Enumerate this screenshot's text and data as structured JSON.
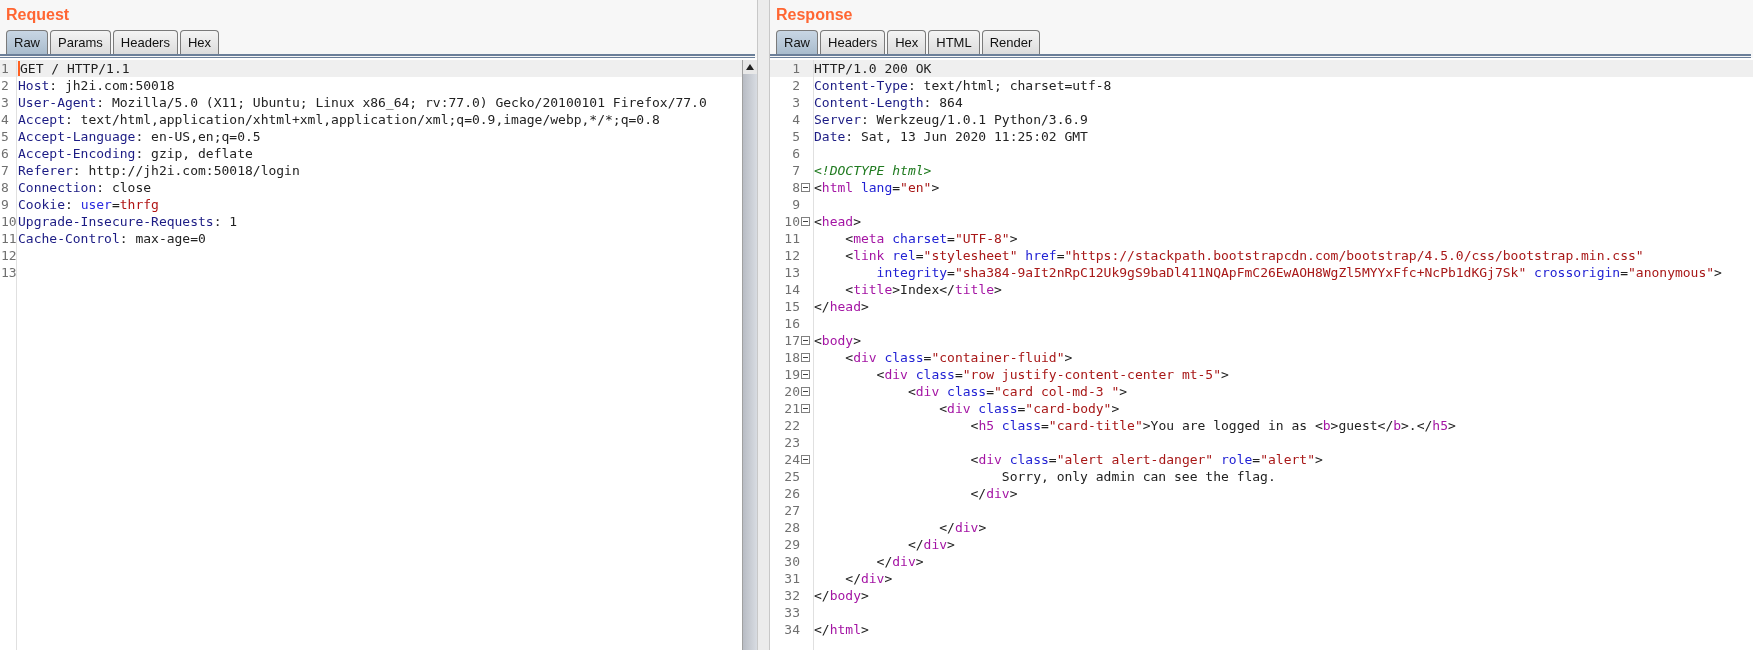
{
  "panes": [
    {
      "title": "Request",
      "caret": true,
      "scrollbar": true,
      "tabs": [
        {
          "label": "Raw",
          "selected": true
        },
        {
          "label": "Params",
          "selected": false
        },
        {
          "label": "Headers",
          "selected": false
        },
        {
          "label": "Hex",
          "selected": false
        }
      ],
      "lines": [
        {
          "number": "1",
          "current": true,
          "fold": false,
          "tokens": [
            {
              "kind": "text",
              "text": "GET / HTTP/1.1"
            }
          ]
        },
        {
          "number": "2",
          "current": false,
          "fold": false,
          "tokens": [
            {
              "kind": "header_name",
              "text": "Host"
            },
            {
              "kind": "text",
              "text": ": jh2i.com:50018"
            }
          ]
        },
        {
          "number": "3",
          "current": false,
          "fold": false,
          "tokens": [
            {
              "kind": "header_name",
              "text": "User-Agent"
            },
            {
              "kind": "text",
              "text": ": Mozilla/5.0 (X11; Ubuntu; Linux x86_64; rv:77.0) Gecko/20100101 Firefox/77.0"
            }
          ]
        },
        {
          "number": "4",
          "current": false,
          "fold": false,
          "tokens": [
            {
              "kind": "header_name",
              "text": "Accept"
            },
            {
              "kind": "text",
              "text": ": text/html,application/xhtml+xml,application/xml;q=0.9,image/webp,*/*;q=0.8"
            }
          ]
        },
        {
          "number": "5",
          "current": false,
          "fold": false,
          "tokens": [
            {
              "kind": "header_name",
              "text": "Accept-Language"
            },
            {
              "kind": "text",
              "text": ": en-US,en;q=0.5"
            }
          ]
        },
        {
          "number": "6",
          "current": false,
          "fold": false,
          "tokens": [
            {
              "kind": "header_name",
              "text": "Accept-Encoding"
            },
            {
              "kind": "text",
              "text": ": gzip, deflate"
            }
          ]
        },
        {
          "number": "7",
          "current": false,
          "fold": false,
          "tokens": [
            {
              "kind": "header_name",
              "text": "Referer"
            },
            {
              "kind": "text",
              "text": ": http://jh2i.com:50018/login"
            }
          ]
        },
        {
          "number": "8",
          "current": false,
          "fold": false,
          "tokens": [
            {
              "kind": "header_name",
              "text": "Connection"
            },
            {
              "kind": "text",
              "text": ": close"
            }
          ]
        },
        {
          "number": "9",
          "current": false,
          "fold": false,
          "tokens": [
            {
              "kind": "header_name",
              "text": "Cookie"
            },
            {
              "kind": "text",
              "text": ": "
            },
            {
              "kind": "param_name",
              "text": "user"
            },
            {
              "kind": "text",
              "text": "="
            },
            {
              "kind": "param_value",
              "text": "thrfg"
            }
          ]
        },
        {
          "number": "10",
          "current": false,
          "fold": false,
          "tokens": [
            {
              "kind": "header_name",
              "text": "Upgrade-Insecure-Requests"
            },
            {
              "kind": "text",
              "text": ": 1"
            }
          ]
        },
        {
          "number": "11",
          "current": false,
          "fold": false,
          "tokens": [
            {
              "kind": "header_name",
              "text": "Cache-Control"
            },
            {
              "kind": "text",
              "text": ": max-age=0"
            }
          ]
        },
        {
          "number": "12",
          "current": false,
          "fold": false
        },
        {
          "number": "13",
          "current": false,
          "fold": false
        }
      ]
    },
    {
      "title": "Response",
      "caret": false,
      "scrollbar": false,
      "tabs": [
        {
          "label": "Raw",
          "selected": true
        },
        {
          "label": "Headers",
          "selected": false
        },
        {
          "label": "Hex",
          "selected": false
        },
        {
          "label": "HTML",
          "selected": false
        },
        {
          "label": "Render",
          "selected": false
        }
      ],
      "lines": [
        {
          "number": "1",
          "current": true,
          "fold": false,
          "tokens": [
            {
              "kind": "text",
              "text": "HTTP/1.0 200 OK"
            }
          ]
        },
        {
          "number": "2",
          "current": false,
          "fold": false,
          "tokens": [
            {
              "kind": "header_name",
              "text": "Content-Type"
            },
            {
              "kind": "text",
              "text": ": text/html; charset=utf-8"
            }
          ]
        },
        {
          "number": "3",
          "current": false,
          "fold": false,
          "tokens": [
            {
              "kind": "header_name",
              "text": "Content-Length"
            },
            {
              "kind": "text",
              "text": ": 864"
            }
          ]
        },
        {
          "number": "4",
          "current": false,
          "fold": false,
          "tokens": [
            {
              "kind": "header_name",
              "text": "Server"
            },
            {
              "kind": "text",
              "text": ": Werkzeug/1.0.1 Python/3.6.9"
            }
          ]
        },
        {
          "number": "5",
          "current": false,
          "fold": false,
          "tokens": [
            {
              "kind": "header_name",
              "text": "Date"
            },
            {
              "kind": "text",
              "text": ": Sat, 13 Jun 2020 11:25:02 GMT"
            }
          ]
        },
        {
          "number": "6",
          "current": false,
          "fold": false
        },
        {
          "number": "7",
          "current": false,
          "fold": false,
          "tokens": [
            {
              "kind": "comment",
              "text": "<!DOCTYPE html>"
            }
          ]
        },
        {
          "number": "8",
          "current": false,
          "fold": true,
          "tokens": [
            {
              "kind": "text",
              "text": "<"
            },
            {
              "kind": "tag",
              "text": "html"
            },
            {
              "kind": "attr",
              "text": " lang"
            },
            {
              "kind": "text",
              "text": "="
            },
            {
              "kind": "string",
              "text": "\"en\""
            },
            {
              "kind": "text",
              "text": ">"
            }
          ]
        },
        {
          "number": "9",
          "current": false,
          "fold": false
        },
        {
          "number": "10",
          "current": false,
          "fold": true,
          "tokens": [
            {
              "kind": "text",
              "text": "<"
            },
            {
              "kind": "tag",
              "text": "head"
            },
            {
              "kind": "text",
              "text": ">"
            }
          ]
        },
        {
          "number": "11",
          "current": false,
          "fold": false,
          "tokens": [
            {
              "kind": "text",
              "text": "    <"
            },
            {
              "kind": "tag",
              "text": "meta"
            },
            {
              "kind": "attr",
              "text": " charset"
            },
            {
              "kind": "text",
              "text": "="
            },
            {
              "kind": "string",
              "text": "\"UTF-8\""
            },
            {
              "kind": "text",
              "text": ">"
            }
          ]
        },
        {
          "number": "12",
          "current": false,
          "fold": false,
          "tokens": [
            {
              "kind": "text",
              "text": "    <"
            },
            {
              "kind": "tag",
              "text": "link"
            },
            {
              "kind": "attr",
              "text": " rel"
            },
            {
              "kind": "text",
              "text": "="
            },
            {
              "kind": "string",
              "text": "\"stylesheet\""
            },
            {
              "kind": "attr",
              "text": " href"
            },
            {
              "kind": "text",
              "text": "="
            },
            {
              "kind": "string",
              "text": "\"https://stackpath.bootstrapcdn.com/bootstrap/4.5.0/css/bootstrap.min.css\""
            }
          ]
        },
        {
          "number": "13",
          "current": false,
          "fold": false,
          "tokens": [
            {
              "kind": "attr",
              "text": "        integrity"
            },
            {
              "kind": "text",
              "text": "="
            },
            {
              "kind": "string",
              "text": "\"sha384-9aIt2nRpC12Uk9gS9baDl411NQApFmC26EwAOH8WgZl5MYYxFfc+NcPb1dKGj7Sk\""
            },
            {
              "kind": "attr",
              "text": " crossorigin"
            },
            {
              "kind": "text",
              "text": "="
            },
            {
              "kind": "string",
              "text": "\"anonymous\""
            },
            {
              "kind": "text",
              "text": ">"
            }
          ]
        },
        {
          "number": "14",
          "current": false,
          "fold": false,
          "tokens": [
            {
              "kind": "text",
              "text": "    <"
            },
            {
              "kind": "tag",
              "text": "title"
            },
            {
              "kind": "text",
              "text": ">Index</"
            },
            {
              "kind": "tag",
              "text": "title"
            },
            {
              "kind": "text",
              "text": ">"
            }
          ]
        },
        {
          "number": "15",
          "current": false,
          "fold": false,
          "tokens": [
            {
              "kind": "text",
              "text": "</"
            },
            {
              "kind": "tag",
              "text": "head"
            },
            {
              "kind": "text",
              "text": ">"
            }
          ]
        },
        {
          "number": "16",
          "current": false,
          "fold": false
        },
        {
          "number": "17",
          "current": false,
          "fold": true,
          "tokens": [
            {
              "kind": "text",
              "text": "<"
            },
            {
              "kind": "tag",
              "text": "body"
            },
            {
              "kind": "text",
              "text": ">"
            }
          ]
        },
        {
          "number": "18",
          "current": false,
          "fold": true,
          "tokens": [
            {
              "kind": "text",
              "text": "    <"
            },
            {
              "kind": "tag",
              "text": "div"
            },
            {
              "kind": "attr",
              "text": " class"
            },
            {
              "kind": "text",
              "text": "="
            },
            {
              "kind": "string",
              "text": "\"container-fluid\""
            },
            {
              "kind": "text",
              "text": ">"
            }
          ]
        },
        {
          "number": "19",
          "current": false,
          "fold": true,
          "tokens": [
            {
              "kind": "text",
              "text": "        <"
            },
            {
              "kind": "tag",
              "text": "div"
            },
            {
              "kind": "attr",
              "text": " class"
            },
            {
              "kind": "text",
              "text": "="
            },
            {
              "kind": "string",
              "text": "\"row justify-content-center mt-5\""
            },
            {
              "kind": "text",
              "text": ">"
            }
          ]
        },
        {
          "number": "20",
          "current": false,
          "fold": true,
          "tokens": [
            {
              "kind": "text",
              "text": "            <"
            },
            {
              "kind": "tag",
              "text": "div"
            },
            {
              "kind": "attr",
              "text": " class"
            },
            {
              "kind": "text",
              "text": "="
            },
            {
              "kind": "string",
              "text": "\"card col-md-3 \""
            },
            {
              "kind": "text",
              "text": ">"
            }
          ]
        },
        {
          "number": "21",
          "current": false,
          "fold": true,
          "tokens": [
            {
              "kind": "text",
              "text": "                <"
            },
            {
              "kind": "tag",
              "text": "div"
            },
            {
              "kind": "attr",
              "text": " class"
            },
            {
              "kind": "text",
              "text": "="
            },
            {
              "kind": "string",
              "text": "\"card-body\""
            },
            {
              "kind": "text",
              "text": ">"
            }
          ]
        },
        {
          "number": "22",
          "current": false,
          "fold": false,
          "tokens": [
            {
              "kind": "text",
              "text": "                    <"
            },
            {
              "kind": "tag",
              "text": "h5"
            },
            {
              "kind": "attr",
              "text": " class"
            },
            {
              "kind": "text",
              "text": "="
            },
            {
              "kind": "string",
              "text": "\"card-title\""
            },
            {
              "kind": "text",
              "text": ">You are logged in as <"
            },
            {
              "kind": "tag",
              "text": "b"
            },
            {
              "kind": "text",
              "text": ">guest</"
            },
            {
              "kind": "tag",
              "text": "b"
            },
            {
              "kind": "text",
              "text": ">.</"
            },
            {
              "kind": "tag",
              "text": "h5"
            },
            {
              "kind": "text",
              "text": ">"
            }
          ]
        },
        {
          "number": "23",
          "current": false,
          "fold": false
        },
        {
          "number": "24",
          "current": false,
          "fold": true,
          "tokens": [
            {
              "kind": "text",
              "text": "                    <"
            },
            {
              "kind": "tag",
              "text": "div"
            },
            {
              "kind": "attr",
              "text": " class"
            },
            {
              "kind": "text",
              "text": "="
            },
            {
              "kind": "string",
              "text": "\"alert alert-danger\""
            },
            {
              "kind": "attr",
              "text": " role"
            },
            {
              "kind": "text",
              "text": "="
            },
            {
              "kind": "string",
              "text": "\"alert\""
            },
            {
              "kind": "text",
              "text": ">"
            }
          ]
        },
        {
          "number": "25",
          "current": false,
          "fold": false,
          "tokens": [
            {
              "kind": "text",
              "text": "                        Sorry, only admin can see the flag."
            }
          ]
        },
        {
          "number": "26",
          "current": false,
          "fold": false,
          "tokens": [
            {
              "kind": "text",
              "text": "                    </"
            },
            {
              "kind": "tag",
              "text": "div"
            },
            {
              "kind": "text",
              "text": ">"
            }
          ]
        },
        {
          "number": "27",
          "current": false,
          "fold": false
        },
        {
          "number": "28",
          "current": false,
          "fold": false,
          "tokens": [
            {
              "kind": "text",
              "text": "                </"
            },
            {
              "kind": "tag",
              "text": "div"
            },
            {
              "kind": "text",
              "text": ">"
            }
          ]
        },
        {
          "number": "29",
          "current": false,
          "fold": false,
          "tokens": [
            {
              "kind": "text",
              "text": "            </"
            },
            {
              "kind": "tag",
              "text": "div"
            },
            {
              "kind": "text",
              "text": ">"
            }
          ]
        },
        {
          "number": "30",
          "current": false,
          "fold": false,
          "tokens": [
            {
              "kind": "text",
              "text": "        </"
            },
            {
              "kind": "tag",
              "text": "div"
            },
            {
              "kind": "text",
              "text": ">"
            }
          ]
        },
        {
          "number": "31",
          "current": false,
          "fold": false,
          "tokens": [
            {
              "kind": "text",
              "text": "    </"
            },
            {
              "kind": "tag",
              "text": "div"
            },
            {
              "kind": "text",
              "text": ">"
            }
          ]
        },
        {
          "number": "32",
          "current": false,
          "fold": false,
          "tokens": [
            {
              "kind": "text",
              "text": "</"
            },
            {
              "kind": "tag",
              "text": "body"
            },
            {
              "kind": "text",
              "text": ">"
            }
          ]
        },
        {
          "number": "33",
          "current": false,
          "fold": false
        },
        {
          "number": "34",
          "current": false,
          "fold": false,
          "tokens": [
            {
              "kind": "text",
              "text": "</"
            },
            {
              "kind": "tag",
              "text": "html"
            },
            {
              "kind": "text",
              "text": ">"
            }
          ]
        }
      ]
    }
  ]
}
